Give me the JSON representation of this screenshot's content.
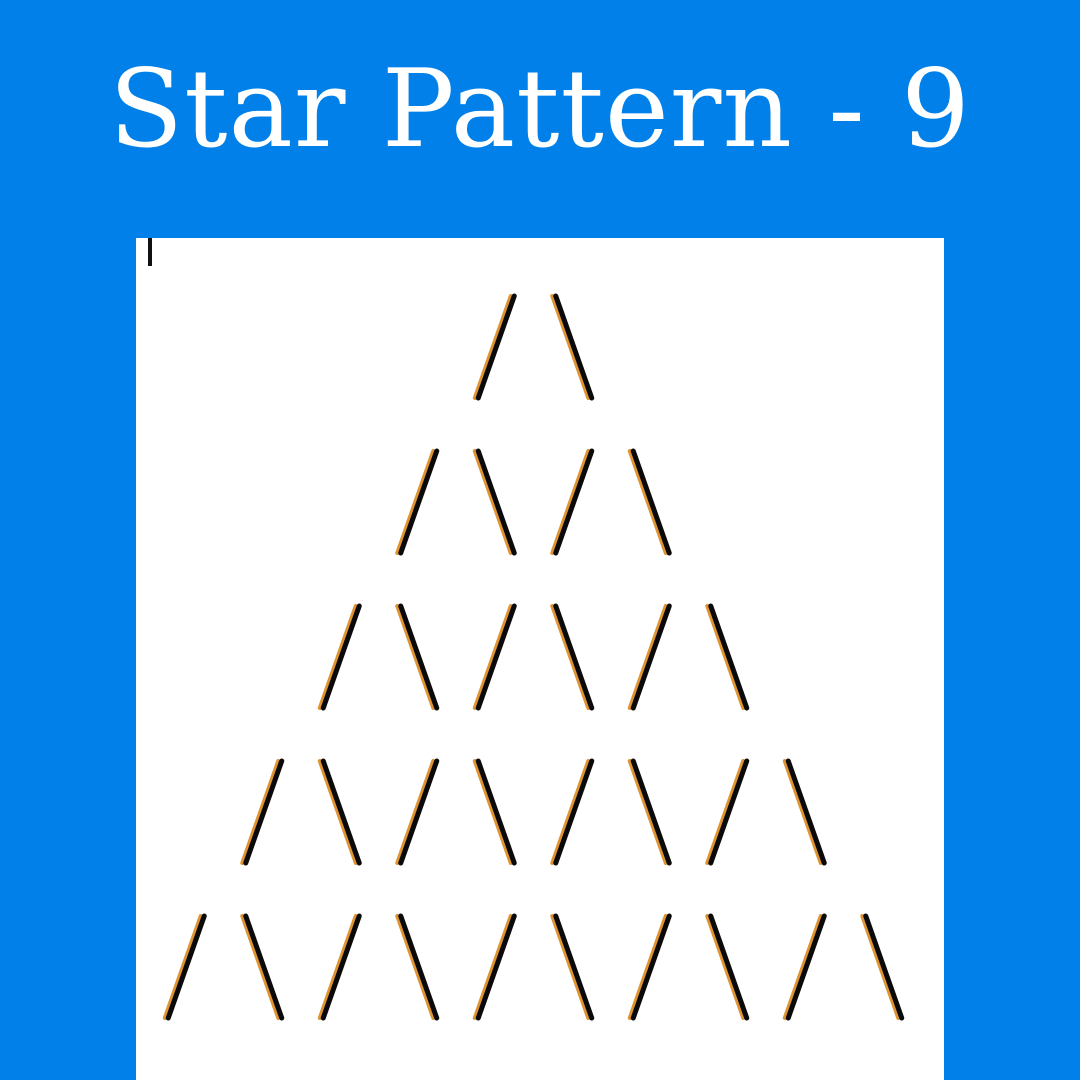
{
  "title": "Star Pattern - 9",
  "colors": {
    "background": "#0080e8",
    "panel": "#ffffff",
    "stroke": "#0a0a0a",
    "stroke_fringe": "#d9820f",
    "title_text": "#ffffff"
  },
  "pattern": {
    "rows": [
      "/\\",
      "/\\/\\",
      "/\\/\\/\\",
      "/\\/\\/\\/\\",
      "/\\/\\/\\/\\/\\"
    ]
  }
}
